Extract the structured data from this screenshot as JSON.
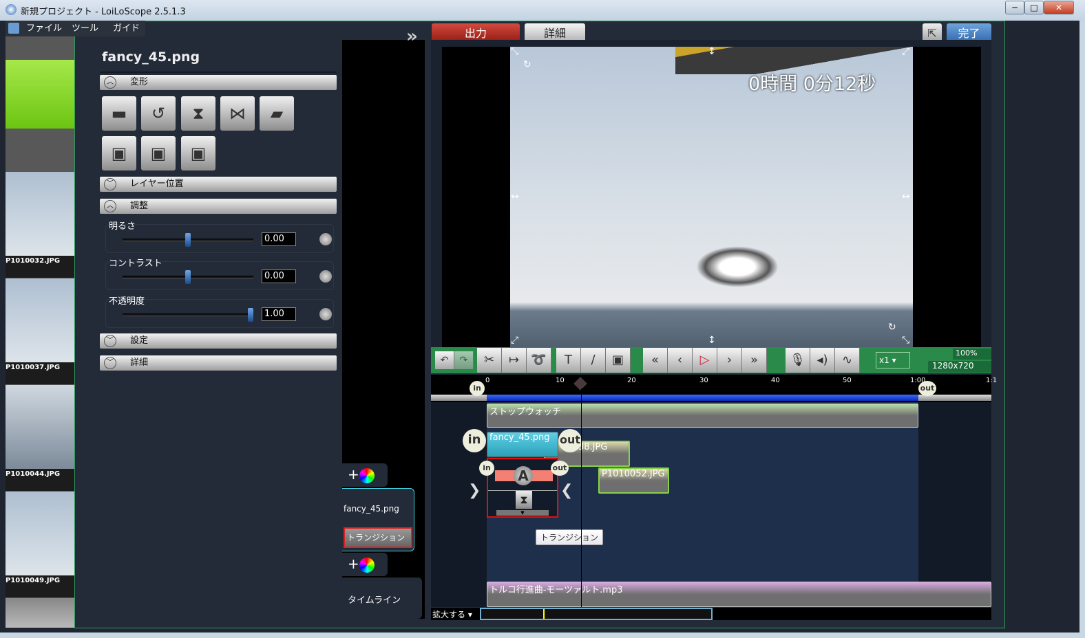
{
  "window": {
    "title": "新規プロジェクト - LoiLoScope 2.5.1.3",
    "minimize": "─",
    "maximize": "□",
    "close": "✕"
  },
  "menu": {
    "file": "ファイル",
    "tools": "ツール",
    "guide": "ガイド"
  },
  "thumbnails": [
    {
      "label": "P1010032.JPG"
    },
    {
      "label": "P1010037.JPG"
    },
    {
      "label": "P1010044.JPG"
    },
    {
      "label": "P1010049.JPG"
    }
  ],
  "props": {
    "title": "fancy_45.png",
    "sections": {
      "transform": "変形",
      "layer": "レイヤー位置",
      "adjust": "調整",
      "settings": "設定",
      "details": "詳細"
    },
    "sliders": [
      {
        "label": "明るさ",
        "value": "0.00",
        "position": 0.5
      },
      {
        "label": "コントラスト",
        "value": "0.00",
        "position": 0.5
      },
      {
        "label": "不透明度",
        "value": "1.00",
        "position": 1.0
      }
    ]
  },
  "header": {
    "output": "出力",
    "details": "詳細",
    "done": "完了",
    "expand": "»"
  },
  "preview": {
    "time": "0時間 0分12秒"
  },
  "toolbar": {
    "speed": "x1",
    "zoom": "100%",
    "resolution": "1280x720"
  },
  "ruler": {
    "ticks": [
      "0",
      "10",
      "20",
      "30",
      "40",
      "50",
      "1:00",
      "1:1"
    ],
    "playhead_seconds": 13,
    "in": "in",
    "out": "out"
  },
  "clips": {
    "stopwatch": "ストップウォッチ",
    "fancy": "fancy_45.png",
    "jpg1": "38.JPG",
    "jpg2": "P1010052.JPG",
    "audio": "トルコ行進曲-モーツァルト.mp3",
    "transition_tooltip": "トランジション",
    "a_label": "A",
    "in": "in",
    "out": "out"
  },
  "column": {
    "layer_name": "fancy_45.png",
    "transition": "トランジション",
    "timeline": "タイムライン",
    "add": "+"
  },
  "bottom": {
    "zoom": "拡大する"
  }
}
